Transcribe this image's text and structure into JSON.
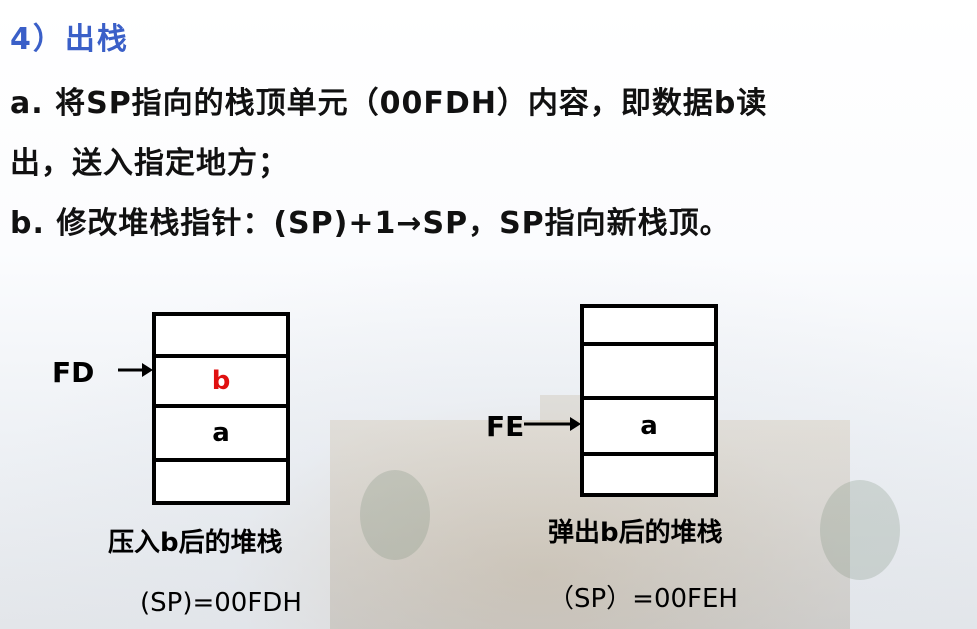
{
  "heading": "4）出栈",
  "lines": {
    "a_text": "a. 将SP指向的栈顶单元（00FDH）内容，即数据b读",
    "a_cont": "出，送入指定地方；",
    "b_text": "b. 修改堆栈指针：(SP)+1→SP，SP指向新栈顶。"
  },
  "left_stack": {
    "pointer_label": "FD",
    "cells": [
      "",
      "b",
      "a",
      ""
    ],
    "caption": "压入b后的堆栈",
    "sp": "(SP)=00FDH"
  },
  "right_stack": {
    "pointer_label": "FE",
    "cells": [
      "",
      "",
      "a",
      ""
    ],
    "caption": "弹出b后的堆栈",
    "sp": "（SP）=00FEH"
  },
  "colors": {
    "heading": "#3a5fc8",
    "highlight": "#e01010"
  }
}
